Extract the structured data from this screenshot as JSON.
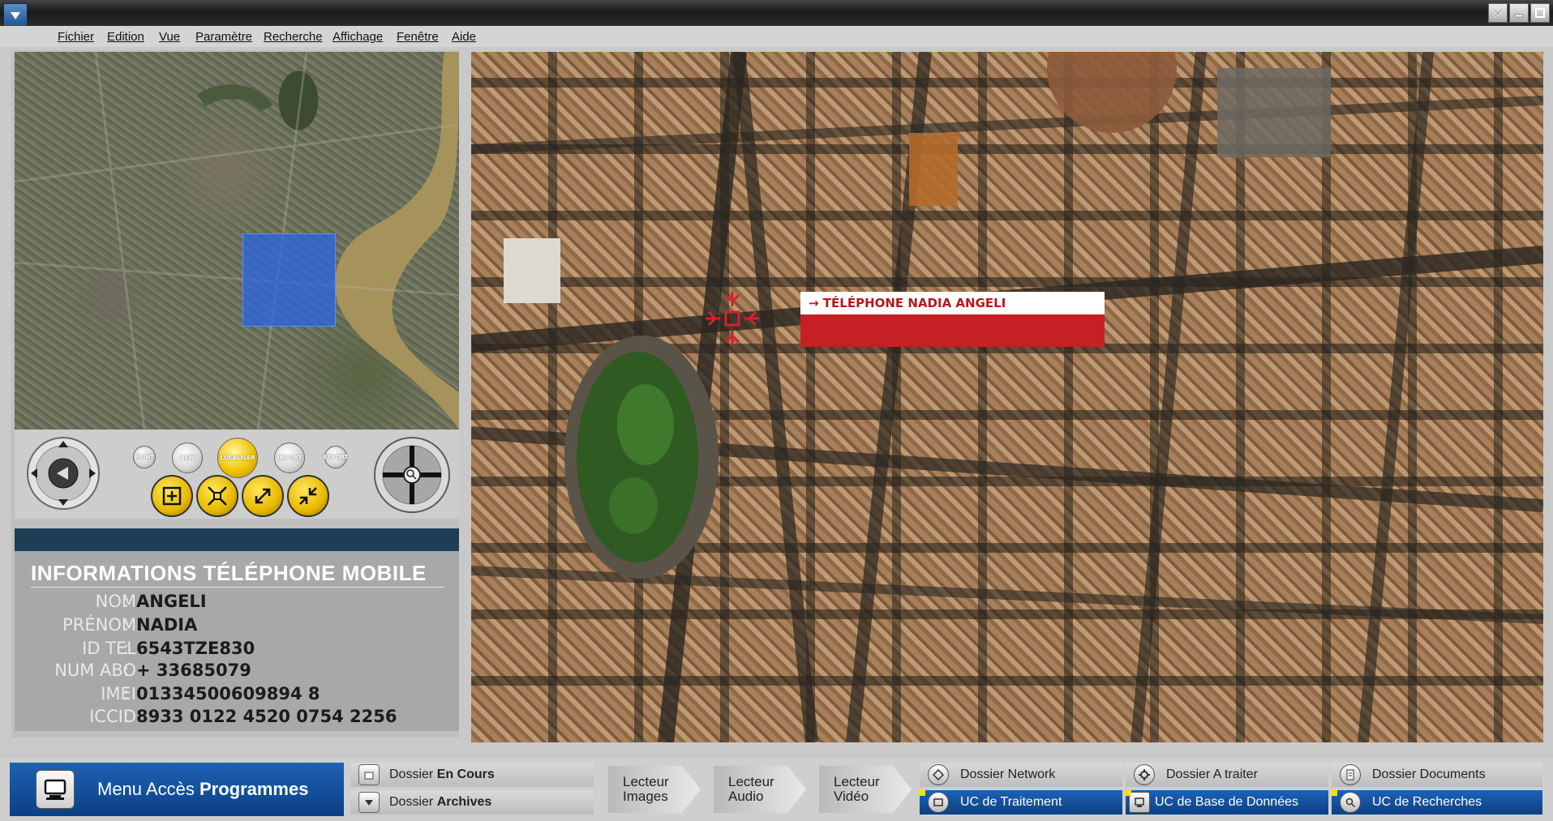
{
  "menubar": {
    "items": [
      "Fichier",
      "Edition",
      "Vue",
      "Paramètre",
      "Recherche",
      "Affichage",
      "Fenêtre",
      "Aide"
    ]
  },
  "controls": {
    "small_buttons": [
      "PRINT",
      "NEW",
      "LOCALISER",
      "IMPORT",
      "EXPORT"
    ],
    "zoom_icons": [
      "fit-icon",
      "center-icon",
      "zoom-in-icon",
      "zoom-out-icon"
    ]
  },
  "info": {
    "title": "INFORMATIONS TÉLÉPHONE MOBILE",
    "rows": [
      {
        "label": "NOM",
        "value": "ANGELI"
      },
      {
        "label": "PRÉNOM",
        "value": "NADIA"
      },
      {
        "label": "ID TEL",
        "value": "6543TZE830"
      },
      {
        "label": "NUM ABO",
        "value": "+ 33685079"
      },
      {
        "label": "IMEI",
        "value": "01334500609894 8"
      },
      {
        "label": "ICCID",
        "value": "8933 0122 4520 0754 2256"
      }
    ]
  },
  "map": {
    "callout": "→ TÉLÉPHONE NADIA ANGELI"
  },
  "colors": {
    "accent_blue": "#0b3f84",
    "callout_red": "#c52124",
    "info_bar": "#1d3f56"
  },
  "taskbar": {
    "program_menu": {
      "prefix": "Menu Accès ",
      "bold": "Programmes"
    },
    "dossier_en_cours": {
      "prefix": "Dossier ",
      "bold": "En Cours"
    },
    "dossier_archives": {
      "prefix": "Dossier ",
      "bold": "Archives"
    },
    "lecteurs": [
      "Lecteur\nImages",
      "Lecteur\nAudio",
      "Lecteur\nVidéo"
    ],
    "right_buttons": [
      {
        "label": "Dossier Network",
        "icon": "network-icon"
      },
      {
        "label": "Dossier A traiter",
        "icon": "gear-icon"
      },
      {
        "label": "Dossier Documents",
        "icon": "document-icon"
      },
      {
        "label": "UC de Traitement",
        "icon": "processing-icon"
      },
      {
        "label": "UC de Base de Données",
        "icon": "database-icon"
      },
      {
        "label": "UC de Recherches",
        "icon": "search-icon"
      }
    ]
  }
}
